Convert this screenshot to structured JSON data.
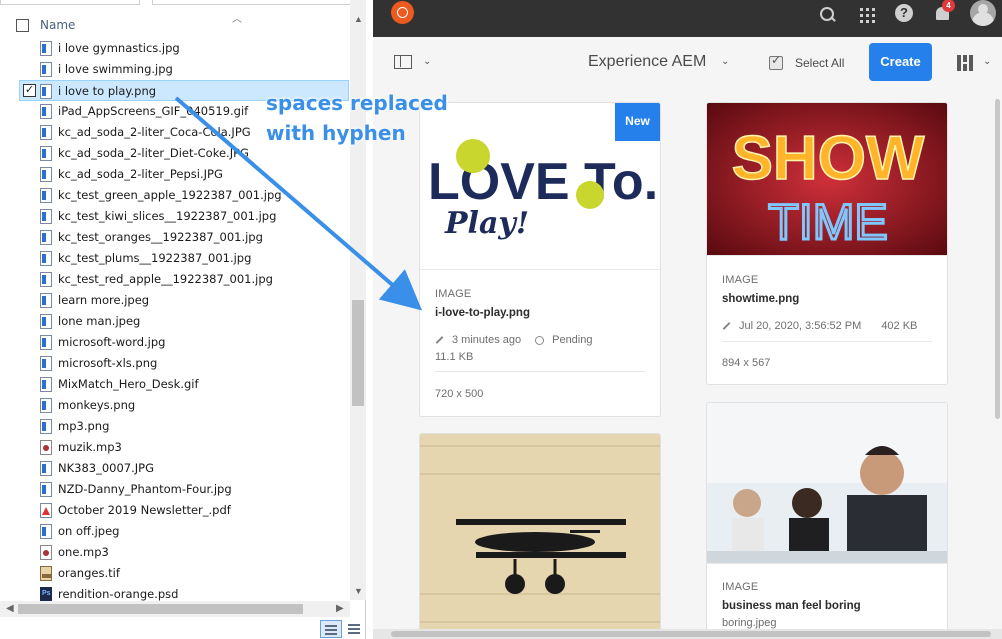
{
  "explorer": {
    "column_header": "Name",
    "files": [
      {
        "name": "i love gymnastics.jpg",
        "type": "image",
        "selected": false
      },
      {
        "name": "i love swimming.jpg",
        "type": "image",
        "selected": false
      },
      {
        "name": "i love to play.png",
        "type": "image",
        "selected": true
      },
      {
        "name": "iPad_AppScreens_GIF_040519.gif",
        "type": "image",
        "selected": false
      },
      {
        "name": "kc_ad_soda_2-liter_Coca-Cola.JPG",
        "type": "image",
        "selected": false
      },
      {
        "name": "kc_ad_soda_2-liter_Diet-Coke.JPG",
        "type": "image",
        "selected": false
      },
      {
        "name": "kc_ad_soda_2-liter_Pepsi.JPG",
        "type": "image",
        "selected": false
      },
      {
        "name": "kc_test_green_apple_1922387_001.jpg",
        "type": "image",
        "selected": false
      },
      {
        "name": "kc_test_kiwi_slices__1922387_001.jpg",
        "type": "image",
        "selected": false
      },
      {
        "name": "kc_test_oranges__1922387_001.jpg",
        "type": "image",
        "selected": false
      },
      {
        "name": "kc_test_plums__1922387_001.jpg",
        "type": "image",
        "selected": false
      },
      {
        "name": "kc_test_red_apple__1922387_001.jpg",
        "type": "image",
        "selected": false
      },
      {
        "name": "learn more.jpeg",
        "type": "image",
        "selected": false
      },
      {
        "name": "lone man.jpeg",
        "type": "image",
        "selected": false
      },
      {
        "name": "microsoft-word.jpg",
        "type": "image",
        "selected": false
      },
      {
        "name": "microsoft-xls.png",
        "type": "image",
        "selected": false
      },
      {
        "name": "MixMatch_Hero_Desk.gif",
        "type": "image",
        "selected": false
      },
      {
        "name": "monkeys.png",
        "type": "image",
        "selected": false
      },
      {
        "name": "mp3.png",
        "type": "image",
        "selected": false
      },
      {
        "name": "muzik.mp3",
        "type": "audio",
        "selected": false
      },
      {
        "name": "NK383_0007.JPG",
        "type": "image",
        "selected": false
      },
      {
        "name": "NZD-Danny_Phantom-Four.jpg",
        "type": "image",
        "selected": false
      },
      {
        "name": "October 2019 Newsletter_.pdf",
        "type": "pdf",
        "selected": false
      },
      {
        "name": "on off.jpeg",
        "type": "image",
        "selected": false
      },
      {
        "name": "one.mp3",
        "type": "audio",
        "selected": false
      },
      {
        "name": "oranges.tif",
        "type": "tif",
        "selected": false
      },
      {
        "name": "rendition-orange.psd",
        "type": "psd",
        "selected": false
      }
    ]
  },
  "annotation": {
    "line1": "spaces replaced",
    "line2": "with hyphen",
    "color": "#3a8fe8"
  },
  "aem": {
    "topbar": {
      "notification_count": "4",
      "help_glyph": "?"
    },
    "actionbar": {
      "context_title": "Experience AEM",
      "select_all_label": "Select All",
      "create_label": "Create"
    },
    "cards": [
      {
        "badge": "New",
        "type": "IMAGE",
        "title": "i-love-to-play.png",
        "modified": "3 minutes ago",
        "status": "Pending",
        "size": "11.1 KB",
        "dimensions": "720 x 500",
        "thumb_text_top": "LOVE To...",
        "thumb_text_bottom": "Play!"
      },
      {
        "type": "IMAGE",
        "title": "showtime.png",
        "modified": "Jul 20, 2020, 3:56:52 PM",
        "size": "402 KB",
        "dimensions": "894 x 567",
        "thumb_text_top": "SHOW",
        "thumb_text_bottom": "TIME"
      },
      {
        "type": "IMAGE",
        "title": "business man feel boring",
        "filename": "boring.jpeg"
      }
    ],
    "colors": {
      "accent": "#2680eb",
      "topbar": "#323232",
      "badge": "#e03a3a"
    }
  }
}
